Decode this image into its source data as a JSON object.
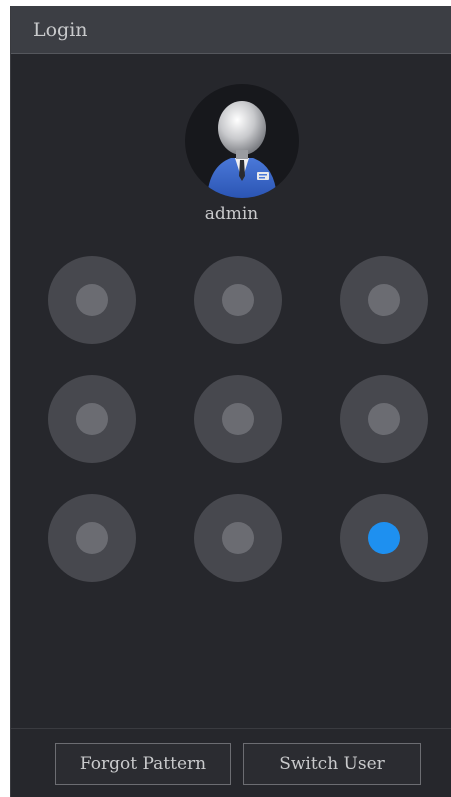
{
  "window": {
    "title": "Login"
  },
  "user": {
    "name": "admin",
    "avatar_icon": "user-avatar-icon"
  },
  "pattern": {
    "rows": 3,
    "cols": 3,
    "active_nodes": [
      9
    ],
    "active_color": "#1e90f0",
    "idle_color": "#6b6c72"
  },
  "buttons": {
    "forgot_pattern": "Forgot Pattern",
    "switch_user": "Switch User"
  }
}
